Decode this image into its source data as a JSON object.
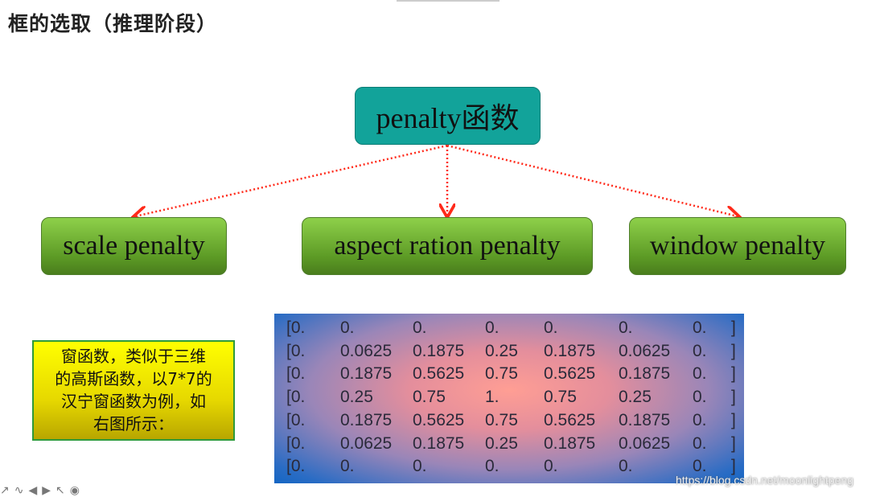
{
  "title": "框的选取（推理阶段）",
  "diagram": {
    "root": "penalty函数",
    "children": [
      "scale penalty",
      "aspect ration penalty",
      "window penalty"
    ],
    "edge_color": "#ff2a1a"
  },
  "note": {
    "lines": [
      "窗函数，类似于三维",
      "的高斯函数，以7*7的",
      "汉宁窗函数为例，如",
      "右图所示："
    ]
  },
  "matrix": {
    "rows": [
      [
        "[0.",
        "0.",
        "0.",
        "0.",
        "0.",
        "0.",
        "0.",
        "]"
      ],
      [
        "[0.",
        "0.0625",
        "0.1875",
        "0.25",
        "0.1875",
        "0.0625",
        "0.",
        "]"
      ],
      [
        "[0.",
        "0.1875",
        "0.5625",
        "0.75",
        "0.5625",
        "0.1875",
        "0.",
        "]"
      ],
      [
        "[0.",
        "0.25",
        "0.75",
        "1.",
        "0.75",
        "0.25",
        "0.",
        "]"
      ],
      [
        "[0.",
        "0.1875",
        "0.5625",
        "0.75",
        "0.5625",
        "0.1875",
        "0.",
        "]"
      ],
      [
        "[0.",
        "0.0625",
        "0.1875",
        "0.25",
        "0.1875",
        "0.0625",
        "0.",
        "]"
      ],
      [
        "[0.",
        "0.",
        "0.",
        "0.",
        "0.",
        "0.",
        "0.",
        "]"
      ]
    ]
  },
  "watermark": "https://blog.csdn.net/moonlightpeng",
  "toolbar": {
    "icons": [
      "pen-icon",
      "curve-icon",
      "arrow-left-icon",
      "arrow-right-icon",
      "pointer-icon",
      "record-icon"
    ],
    "glyphs": "↗∿◀▶↖◉"
  }
}
